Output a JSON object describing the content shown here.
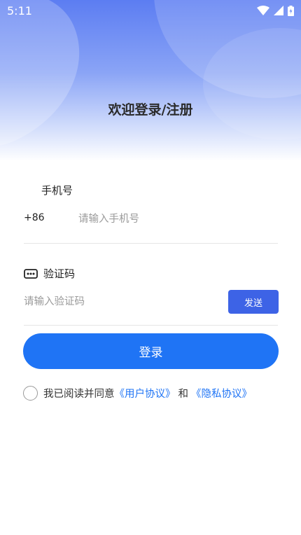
{
  "status_bar": {
    "time": "5:11"
  },
  "header": {
    "title": "欢迎登录/注册"
  },
  "phone": {
    "label": "手机号",
    "prefix": "+86",
    "placeholder": "请输入手机号"
  },
  "code": {
    "label": "验证码",
    "placeholder": "请输入验证码",
    "send_label": "发送"
  },
  "login": {
    "label": "登录"
  },
  "agreement": {
    "prefix": "我已阅读并同意",
    "user_agreement": "《用户协议》",
    "conjunction": "和",
    "privacy_policy": "《隐私协议》",
    "checked": false
  },
  "colors": {
    "accent": "#1f74f5",
    "send_button": "#3d63e6"
  },
  "icons": {
    "code_field": "dots-icon",
    "status": [
      "wifi-icon",
      "signal-icon",
      "battery-icon"
    ]
  }
}
